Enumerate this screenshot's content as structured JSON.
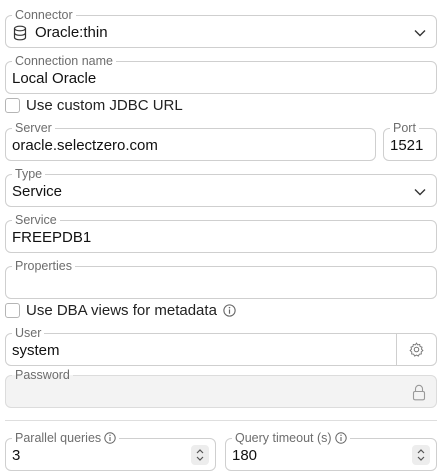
{
  "connector": {
    "label": "Connector",
    "value": "Oracle:thin",
    "icon": "database-icon"
  },
  "connection_name": {
    "label": "Connection name",
    "value": "Local Oracle"
  },
  "custom_jdbc": {
    "label": "Use custom JDBC URL",
    "checked": false
  },
  "server": {
    "label": "Server",
    "value": "oracle.selectzero.com"
  },
  "port": {
    "label": "Port",
    "value": "1521"
  },
  "type": {
    "label": "Type",
    "value": "Service"
  },
  "service": {
    "label": "Service",
    "value": "FREEPDB1"
  },
  "properties": {
    "label": "Properties",
    "value": ""
  },
  "dba_views": {
    "label": "Use DBA views for metadata",
    "checked": false,
    "icon": "info-icon"
  },
  "user": {
    "label": "User",
    "value": "system",
    "icon": "gear-icon"
  },
  "password": {
    "label": "Password",
    "value": "",
    "icon": "lock-icon"
  },
  "parallel_queries": {
    "label": "Parallel queries",
    "value": "3",
    "icon": "info-icon"
  },
  "query_timeout": {
    "label": "Query timeout (s)",
    "value": "180",
    "icon": "info-icon"
  }
}
